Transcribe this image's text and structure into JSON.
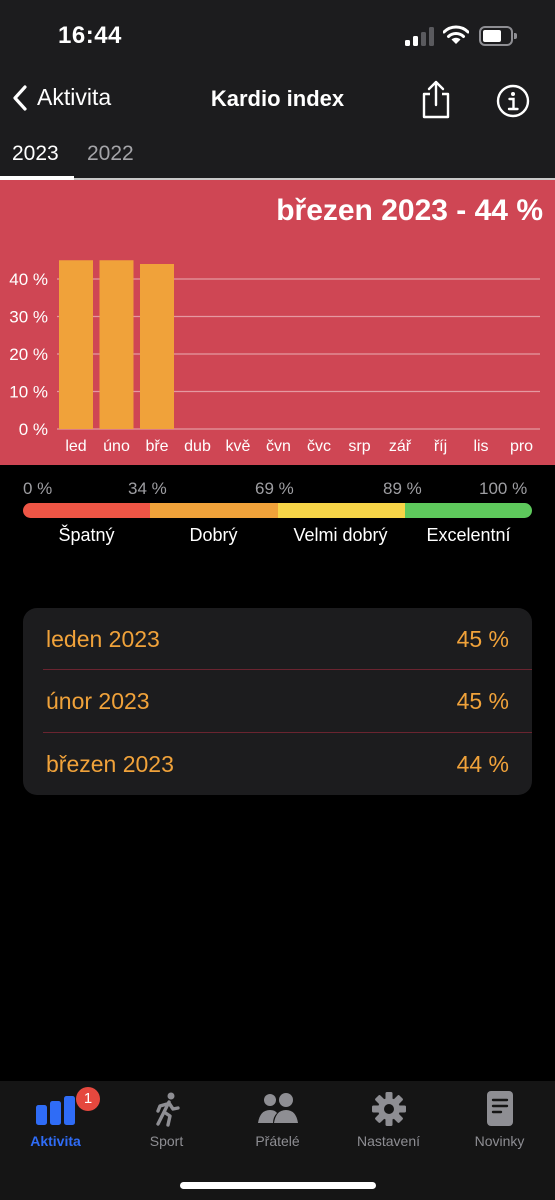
{
  "status_bar": {
    "time": "16:44",
    "signal_bars": 2,
    "signal_total": 4,
    "battery_level": 0.6
  },
  "nav": {
    "back_label": "Aktivita",
    "title": "Kardio index",
    "share_icon": "share-icon",
    "info_icon": "info-icon"
  },
  "year_tabs": [
    {
      "label": "2023",
      "active": true
    },
    {
      "label": "2022",
      "active": false
    }
  ],
  "colors": {
    "chart_bg": "#cf4654",
    "bar": "#f0a23a",
    "accent_blue": "#2f6cf6",
    "list_text": "#f0a23a",
    "scale": [
      "#ee5545",
      "#f0a23a",
      "#f7d548",
      "#5ec95c"
    ]
  },
  "chart_data": {
    "type": "bar",
    "title": "březen 2023 - 44 %",
    "categories": [
      "led",
      "úno",
      "bře",
      "dub",
      "kvě",
      "čvn",
      "čvc",
      "srp",
      "zář",
      "říj",
      "lis",
      "pro"
    ],
    "values": [
      45,
      45,
      44,
      null,
      null,
      null,
      null,
      null,
      null,
      null,
      null,
      null
    ],
    "yticks": [
      0,
      10,
      20,
      30,
      40
    ],
    "ytick_labels": [
      "0 %",
      "10 %",
      "20 %",
      "30 %",
      "40 %"
    ],
    "ylim": [
      0,
      40
    ],
    "xlabel": "",
    "ylabel": "",
    "grid": true,
    "unit": "%"
  },
  "scale": {
    "ticks": [
      "0 %",
      "34 %",
      "69 %",
      "89 %",
      "100 %"
    ],
    "labels": [
      "Špatný",
      "Dobrý",
      "Velmi dobrý",
      "Excelentní"
    ]
  },
  "list": [
    {
      "label": "leden 2023",
      "value": "45 %"
    },
    {
      "label": "únor 2023",
      "value": "45 %"
    },
    {
      "label": "březen 2023",
      "value": "44 %"
    }
  ],
  "tabbar": {
    "items": [
      {
        "label": "Aktivita",
        "icon": "activity-bars-icon",
        "active": true,
        "badge": "1"
      },
      {
        "label": "Sport",
        "icon": "running-icon",
        "active": false
      },
      {
        "label": "Přátelé",
        "icon": "friends-icon",
        "active": false
      },
      {
        "label": "Nastavení",
        "icon": "gear-icon",
        "active": false
      },
      {
        "label": "Novinky",
        "icon": "news-icon",
        "active": false
      }
    ]
  }
}
